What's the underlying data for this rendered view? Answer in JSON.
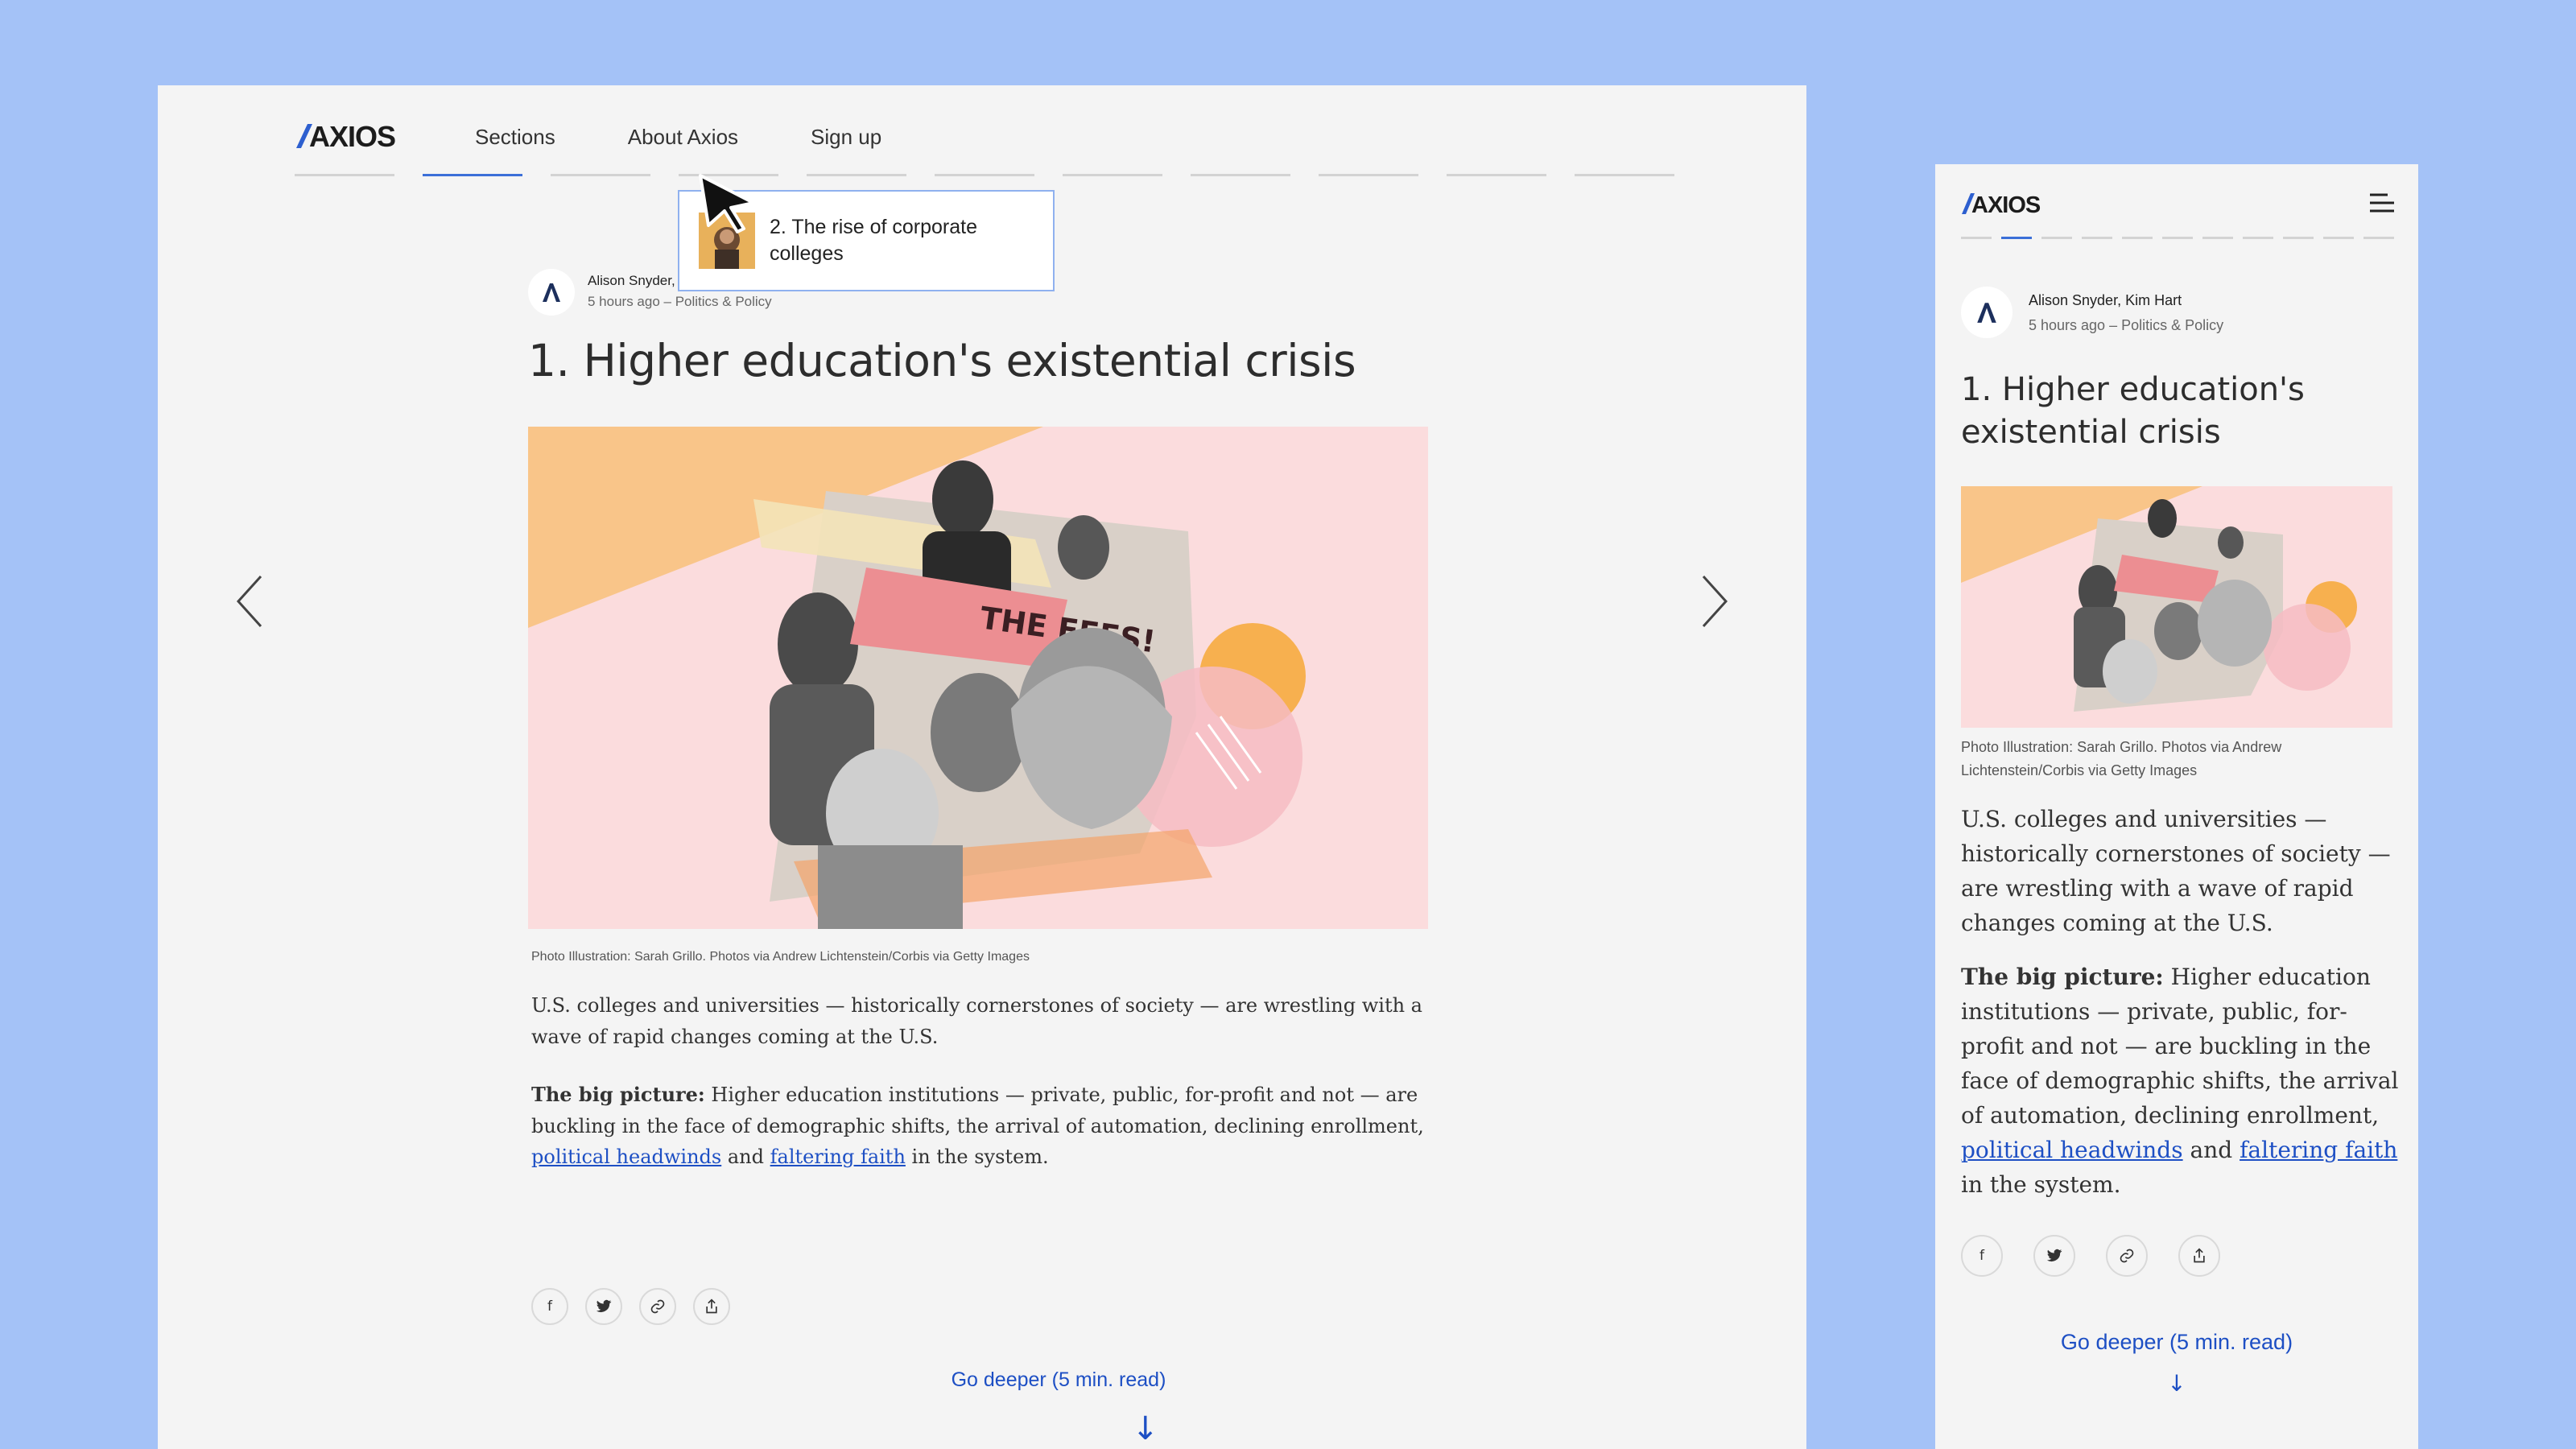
{
  "brand": {
    "logo_text": "AXIOS",
    "accent": "#1d4fc4",
    "background": "#a4c2f7"
  },
  "desktop": {
    "nav": [
      {
        "label": "Sections"
      },
      {
        "label": "About Axios"
      },
      {
        "label": "Sign up"
      }
    ],
    "story_dashes": {
      "count": 11,
      "active_index": 1
    },
    "tooltip": {
      "text": "2. The rise of corporate colleges"
    },
    "byline": {
      "authors": "Alison Snyder,",
      "meta": "5 hours ago – Politics & Policy"
    },
    "title": "1. Higher education's existential crisis",
    "hero_alt_sign": "THE FEES!",
    "caption": "Photo Illustration: Sarah Grillo. Photos via Andrew Lichtenstein/Corbis via Getty Images",
    "body": {
      "p1": "U.S. colleges and universities — historically cornerstones of society — are wrestling with a wave of rapid changes coming at the U.S.",
      "big_picture_label": "The big picture:",
      "p2_text": " Higher education institutions — private, public, for-profit and not — are buckling in the face of demographic shifts, the arrival of automation, declining enrollment, ",
      "link1": "political headwinds",
      "and": " and ",
      "link2": "faltering faith",
      "p2_end": " in the system."
    },
    "share_icons": [
      "facebook-icon",
      "twitter-icon",
      "link-icon",
      "share-icon"
    ],
    "go_deeper": "Go deeper (5 min. read)",
    "arrow": "↓"
  },
  "mobile": {
    "story_dashes": {
      "count": 11,
      "active_index": 1
    },
    "byline": {
      "authors": "Alison Snyder, Kim Hart",
      "meta": "5 hours ago – Politics & Policy"
    },
    "title": "1. Higher education's existential crisis",
    "caption": "Photo Illustration: Sarah Grillo. Photos via Andrew Lichtenstein/Corbis via Getty Images",
    "go_deeper": "Go deeper (5 min. read)",
    "arrow": "↓"
  }
}
